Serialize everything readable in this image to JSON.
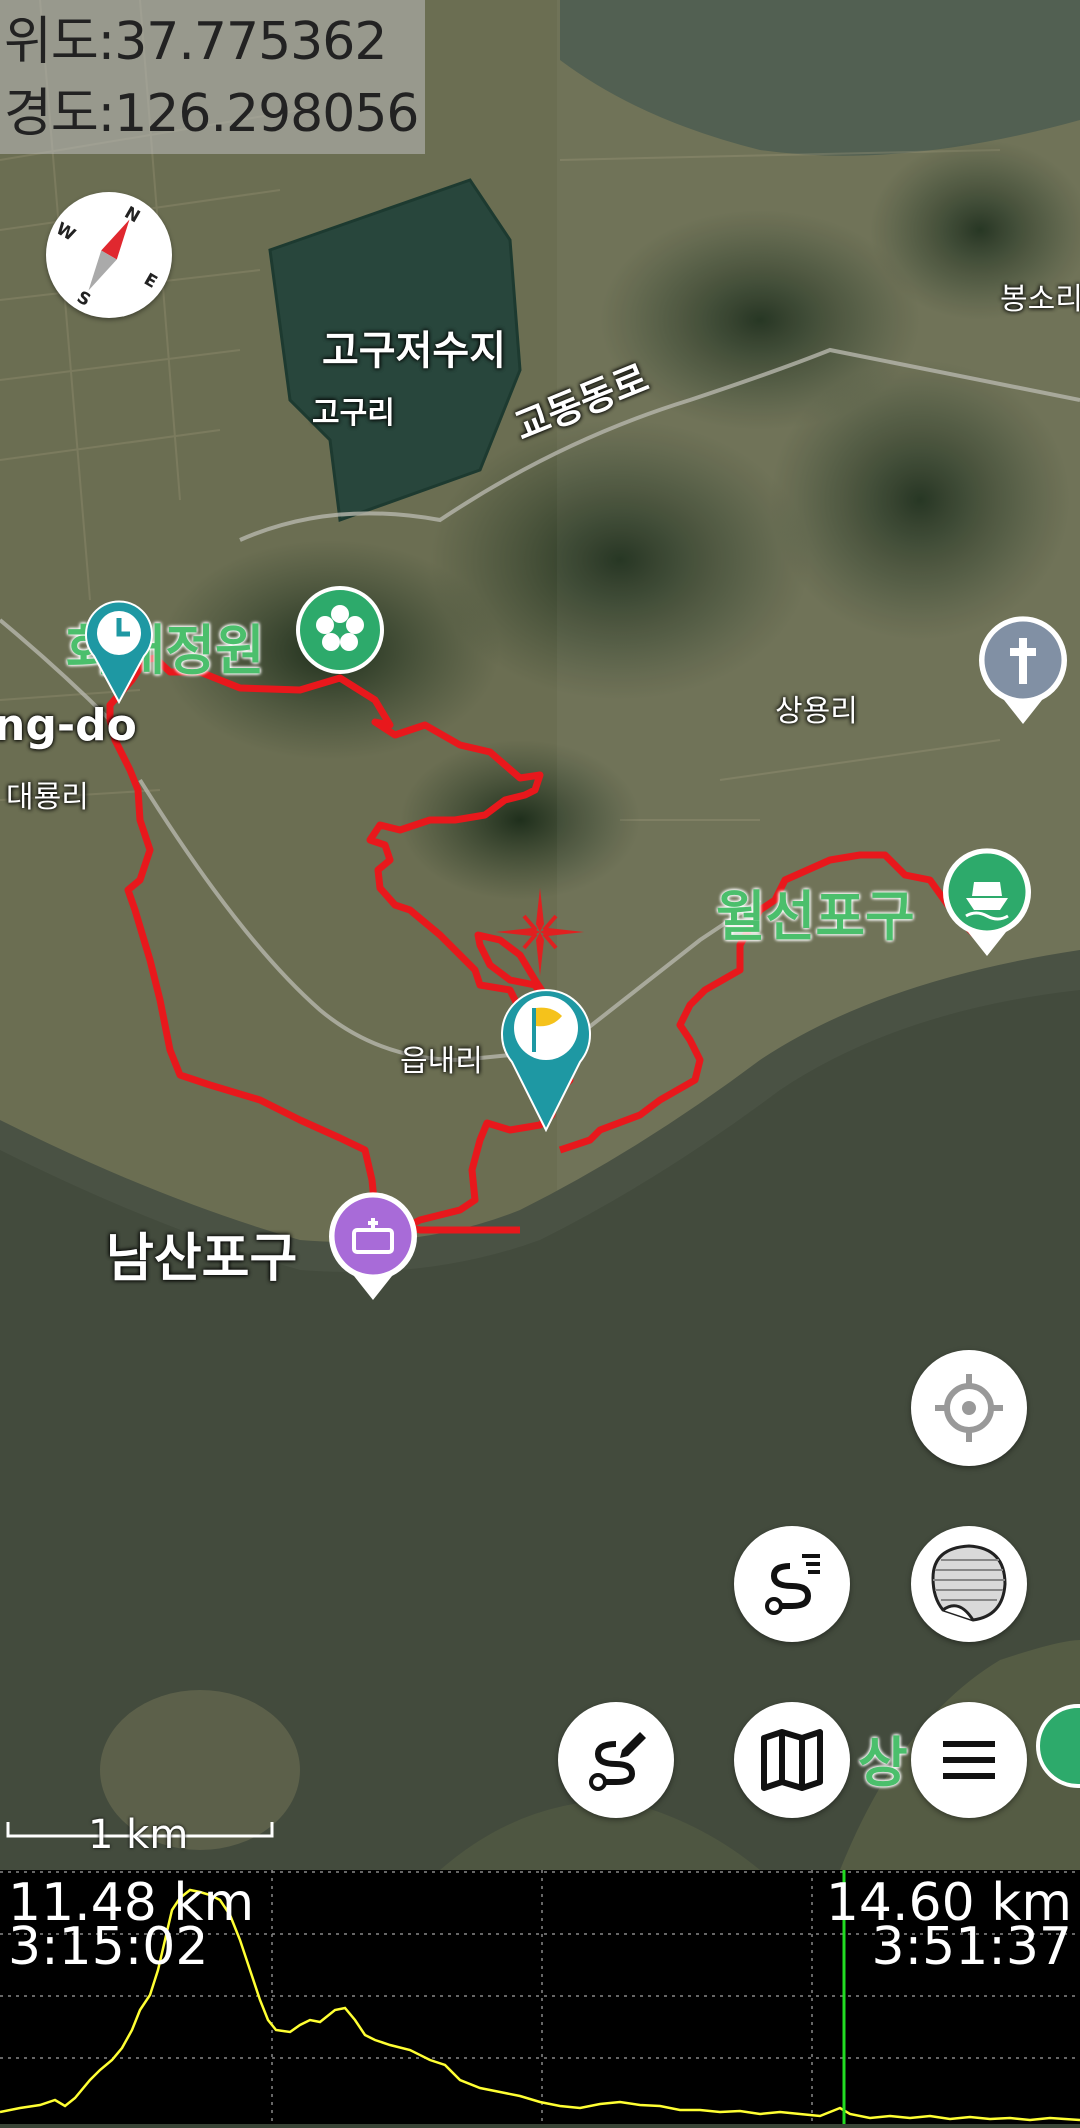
{
  "coords": {
    "lat": "위도:37.775362",
    "lon": "경도:126.298056"
  },
  "places": {
    "reservoir": "고구저수지",
    "gogu": "고구리",
    "gyodong_road": "교동동로",
    "garden": "화개정원",
    "ng_do": "ng-do",
    "daeryong": "대룡리",
    "sangyong": "상용리",
    "wolseon": "월선포구",
    "eupnae": "읍내리",
    "namsan": "남산포구",
    "bongso": "봉소리",
    "sang": "상"
  },
  "scale": {
    "label": "1 km"
  },
  "profile": {
    "left_distance": "11.48 km",
    "left_time": "3:15:02",
    "right_distance": "14.60 km",
    "right_time": "3:51:37",
    "line_color": "#ffff33",
    "cursor_color": "#22dd22"
  },
  "colors": {
    "track": "#e8181c",
    "marker_teal": "#1e98a3",
    "flower_green": "#2daa6b",
    "camp_purple": "#a86bd8",
    "church_gray": "#8190a4"
  },
  "buttons": [
    "my-location",
    "track-list",
    "map-layer",
    "route-draw",
    "offline-map",
    "menu"
  ]
}
